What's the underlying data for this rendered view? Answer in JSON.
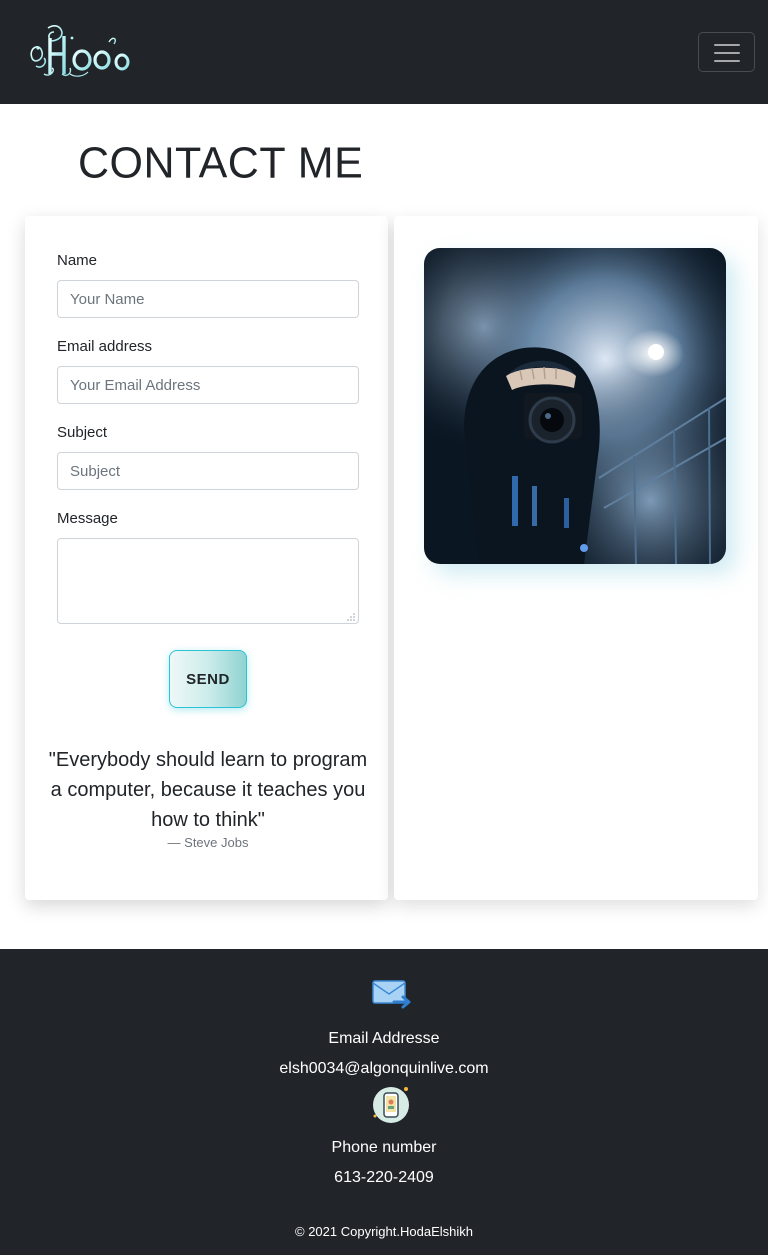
{
  "navbar": {
    "brand": "Hoda",
    "toggle_icon": "hamburger-menu-icon"
  },
  "page": {
    "title": "CONTACT ME"
  },
  "form": {
    "name_label": "Name",
    "name_placeholder": "Your Name",
    "email_label": "Email address",
    "email_placeholder": "Your Email Address",
    "subject_label": "Subject",
    "subject_placeholder": "Subject",
    "message_label": "Message",
    "message_value": "",
    "send_label": "SEND"
  },
  "quote": {
    "text": "\"Everybody should learn to program a computer, because it teaches you how to think\"",
    "author": "— Steve Jobs"
  },
  "photo": {
    "icon": "photographer-camera-image"
  },
  "footer": {
    "email_icon": "envelope-icon",
    "email_heading": "Email Addresse",
    "email_value": "elsh0034@algonquinlive.com",
    "phone_icon": "smartphone-icon",
    "phone_heading": "Phone number",
    "phone_value": "613-220-2409",
    "copyright": "© 2021 Copyright.HodaElshikh"
  },
  "colors": {
    "navbar_bg": "#212529",
    "accent": "#2bc3d6",
    "text": "#212529",
    "muted": "#6c757d"
  }
}
